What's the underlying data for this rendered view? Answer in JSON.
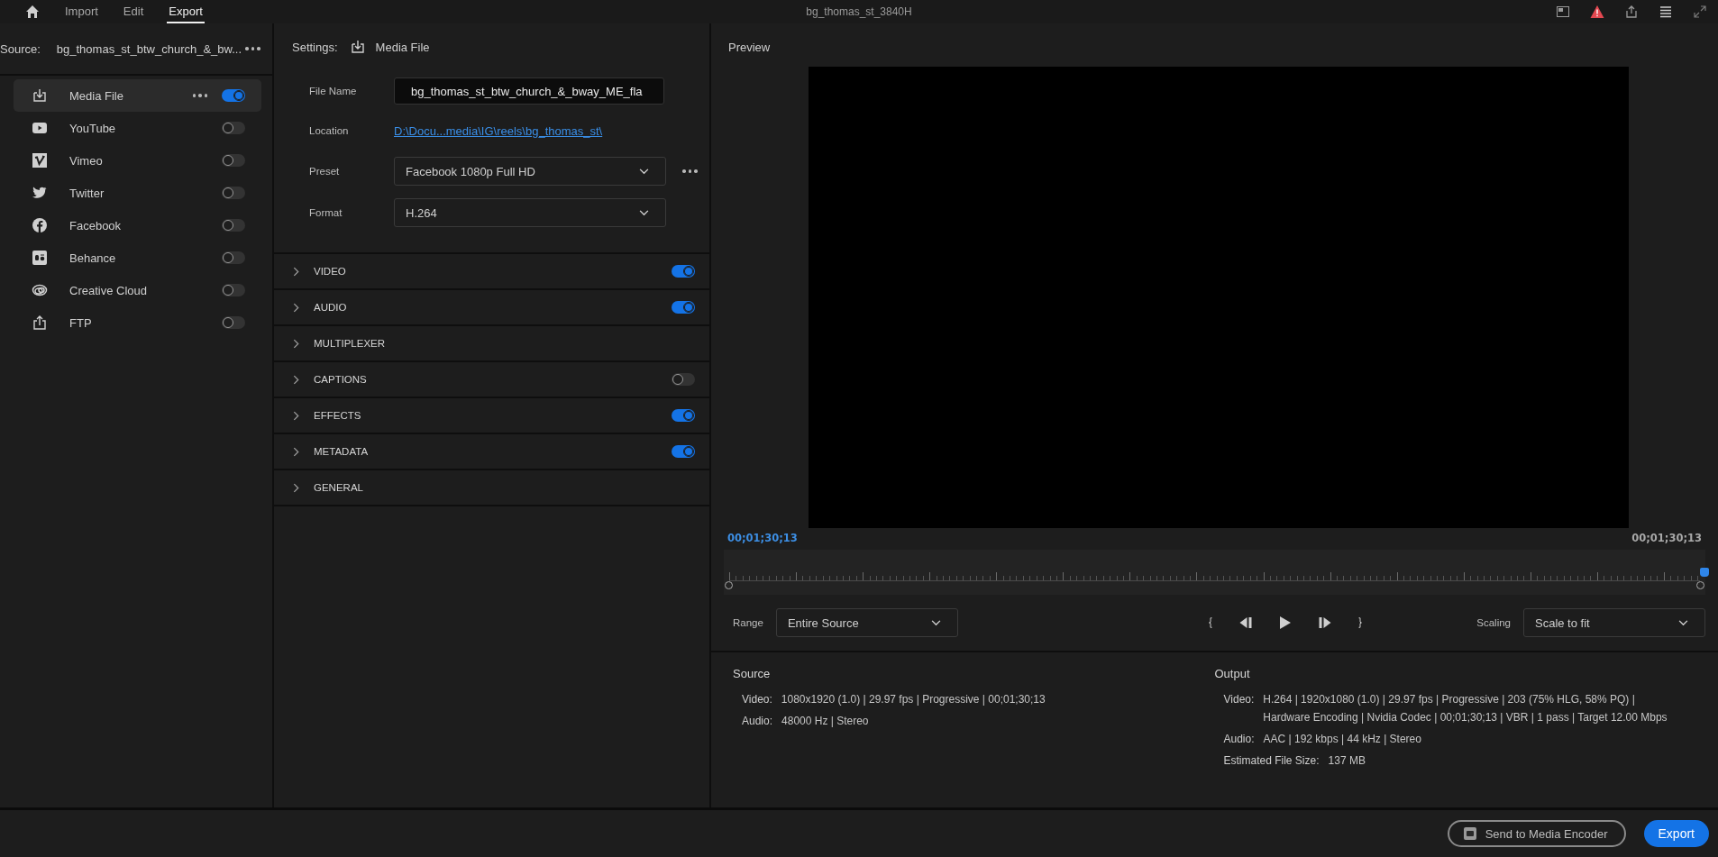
{
  "topbar": {
    "tabs": [
      {
        "label": "Import",
        "selected": false
      },
      {
        "label": "Edit",
        "selected": false
      },
      {
        "label": "Export",
        "selected": true
      }
    ],
    "title": "bg_thomas_st_3840H"
  },
  "source": {
    "label": "Source:",
    "value": "bg_thomas_st_btw_church_&_bw..."
  },
  "destinations": [
    {
      "name": "Media File",
      "on": true,
      "selected": true,
      "more": true
    },
    {
      "name": "YouTube",
      "on": false,
      "selected": false,
      "more": false
    },
    {
      "name": "Vimeo",
      "on": false,
      "selected": false,
      "more": false
    },
    {
      "name": "Twitter",
      "on": false,
      "selected": false,
      "more": false
    },
    {
      "name": "Facebook",
      "on": false,
      "selected": false,
      "more": false
    },
    {
      "name": "Behance",
      "on": false,
      "selected": false,
      "more": false
    },
    {
      "name": "Creative Cloud",
      "on": false,
      "selected": false,
      "more": false
    },
    {
      "name": "FTP",
      "on": false,
      "selected": false,
      "more": false
    }
  ],
  "settings": {
    "label": "Settings:",
    "target": "Media File",
    "fields": [
      {
        "kind": "input",
        "label": "File Name",
        "value": "bg_thomas_st_btw_church_&_bway_ME_fla"
      },
      {
        "kind": "link",
        "label": "Location",
        "value": "D:\\Docu...media\\IG\\reels\\bg_thomas_st\\"
      },
      {
        "kind": "select",
        "label": "Preset",
        "value": "Facebook 1080p Full HD",
        "more": true
      },
      {
        "kind": "select",
        "label": "Format",
        "value": "H.264",
        "more": false
      }
    ],
    "sections": [
      {
        "name": "VIDEO",
        "kind": "toggle",
        "on": true
      },
      {
        "name": "AUDIO",
        "kind": "toggle",
        "on": true
      },
      {
        "name": "MULTIPLEXER",
        "kind": "plain"
      },
      {
        "name": "CAPTIONS",
        "kind": "toggle",
        "on": false
      },
      {
        "name": "EFFECTS",
        "kind": "toggle",
        "on": true
      },
      {
        "name": "METADATA",
        "kind": "toggle",
        "on": true
      },
      {
        "name": "GENERAL",
        "kind": "plain"
      }
    ]
  },
  "preview": {
    "title": "Preview",
    "timecode_current": "00;01;30;13",
    "timecode_duration": "00;01;30;13",
    "playhead": {
      "level": 1
    },
    "range": {
      "label": "Range",
      "value": "Entire Source"
    },
    "scaling": {
      "label": "Scaling",
      "value": "Scale to fit"
    }
  },
  "summary": [
    {
      "title": "Source",
      "rows": [
        {
          "label": "Video:",
          "lines": [
            "1080x1920 (1.0) | 29.97 fps | Progressive | 00;01;30;13"
          ]
        },
        {
          "label": "Audio:",
          "lines": [
            "48000 Hz | Stereo"
          ]
        }
      ]
    },
    {
      "title": "Output",
      "rows": [
        {
          "label": "Video:",
          "lines": [
            "H.264 | 1920x1080 (1.0) | 29.97 fps | Progressive | 203 (75% HLG, 58% PQ) |",
            "Hardware Encoding | Nvidia Codec | 00;01;30;13  | VBR | 1 pass | Target 12.00 Mbps"
          ]
        },
        {
          "label": "Audio:",
          "lines": [
            "AAC | 192 kbps | 44 kHz | Stereo"
          ]
        },
        {
          "label": "Estimated File Size:",
          "lines": [
            "137 MB"
          ]
        }
      ]
    }
  ],
  "footer": {
    "encoder_button": "Send to Media Encoder",
    "export_button": "Export"
  }
}
